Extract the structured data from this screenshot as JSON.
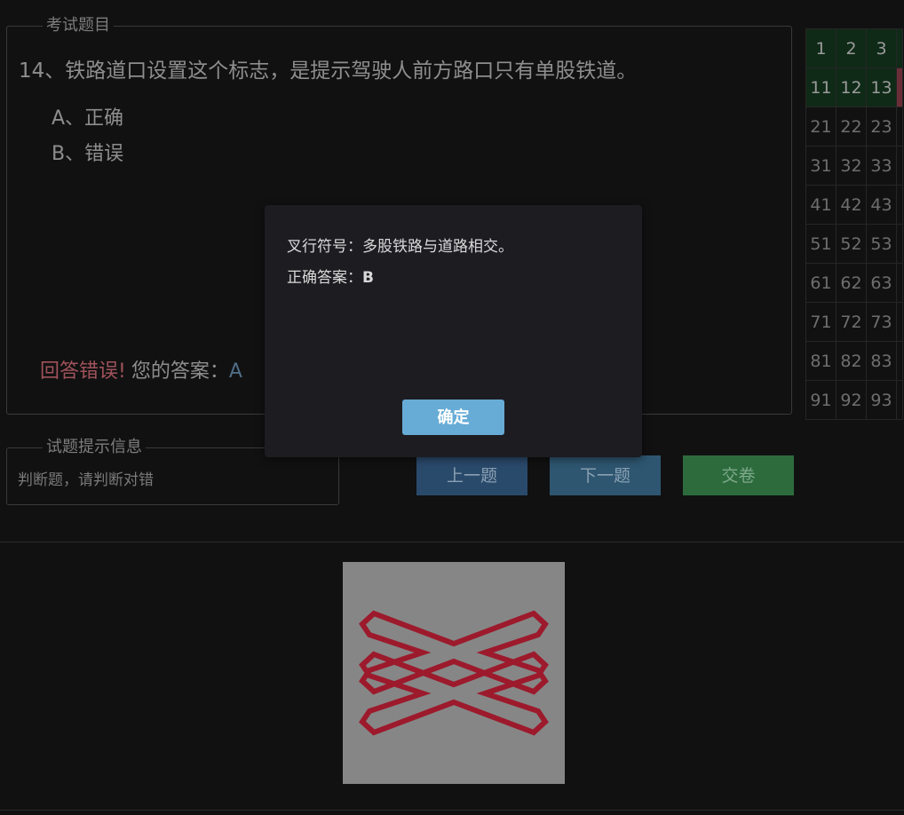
{
  "question_panel": {
    "legend": "考试题目",
    "question": "14、铁路道口设置这个标志，是提示驾驶人前方路口只有单股铁道。",
    "options": [
      "A、正确",
      "B、错误"
    ],
    "result_wrong": "回答错误!",
    "your_answer_label": "您的答案：",
    "your_answer_value": "A"
  },
  "grid": {
    "rows": [
      [
        "1",
        "2",
        "3"
      ],
      [
        "11",
        "12",
        "13"
      ],
      [
        "21",
        "22",
        "23"
      ],
      [
        "31",
        "32",
        "33"
      ],
      [
        "41",
        "42",
        "43"
      ],
      [
        "51",
        "52",
        "53"
      ],
      [
        "61",
        "62",
        "63"
      ],
      [
        "71",
        "72",
        "73"
      ],
      [
        "81",
        "82",
        "83"
      ],
      [
        "91",
        "92",
        "93"
      ]
    ]
  },
  "hint_panel": {
    "legend": "试题提示信息",
    "text": "判断题，请判断对错"
  },
  "buttons": {
    "prev": "上一题",
    "next": "下一题",
    "submit": "交卷"
  },
  "modal": {
    "explanation": "叉行符号：多股铁路与道路相交。",
    "correct_label": "正确答案：",
    "correct_value": "B",
    "ok": "确定"
  },
  "colors": {
    "background": "#111111",
    "wrong_text": "#a0525b",
    "sign_red": "#9c1a2c",
    "ok_button": "#67acd6"
  }
}
